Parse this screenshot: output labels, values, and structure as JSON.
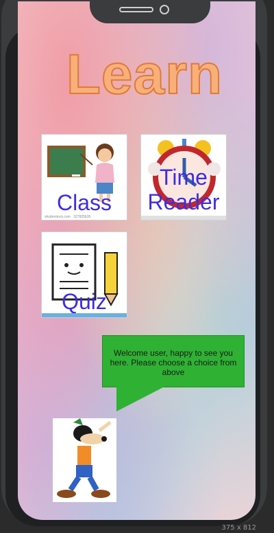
{
  "app": {
    "title": "Learn"
  },
  "tiles": [
    {
      "label": "Class",
      "caption": "shutterstock.com · 327825635",
      "icon": "teacher-icon"
    },
    {
      "label": "Time Reader",
      "icon": "alarm-clock-icon"
    },
    {
      "label": "Quiz",
      "icon": "quiz-paper-icon"
    }
  ],
  "speech_bubble": {
    "text": "Welcome user, happy to see you here. Please choose a choice from above"
  },
  "mascot": {
    "icon": "goofy-mascot-icon"
  },
  "footer": {
    "dimensions": "375 x 812"
  },
  "colors": {
    "label_blue": "#3f2de0",
    "title_orange": "#f8b07a",
    "bubble_green": "#2fb134"
  }
}
